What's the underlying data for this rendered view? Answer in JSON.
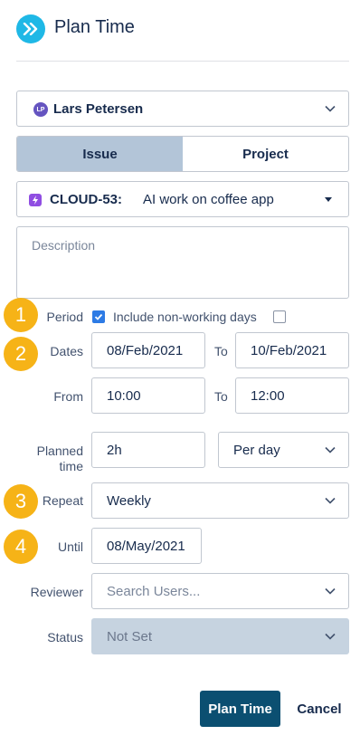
{
  "header": {
    "title": "Plan Time",
    "icon": "double-chevron-right-icon",
    "icon_color": "#1fb8e6"
  },
  "user": {
    "initials": "LP",
    "name": "Lars Petersen"
  },
  "tabs": [
    {
      "label": "Issue",
      "active": true
    },
    {
      "label": "Project",
      "active": false
    }
  ],
  "issue": {
    "key": "CLOUD-53:",
    "summary": "AI work on coffee app"
  },
  "description": {
    "placeholder": "Description"
  },
  "badges": [
    "1",
    "2",
    "3",
    "4"
  ],
  "period": {
    "label": "Period",
    "include_nonworking_label": "Include non-working days",
    "period_checked": true,
    "nonworking_checked": false
  },
  "dates": {
    "label": "Dates",
    "from": "08/Feb/2021",
    "to_label": "To",
    "to": "10/Feb/2021"
  },
  "time": {
    "label": "From",
    "from": "10:00",
    "to_label": "To",
    "to": "12:00"
  },
  "planned": {
    "label_line1": "Planned",
    "label_line2": "time",
    "value": "2h",
    "unit": "Per day"
  },
  "repeat": {
    "label": "Repeat",
    "value": "Weekly"
  },
  "until": {
    "label": "Until",
    "value": "08/May/2021"
  },
  "reviewer": {
    "label": "Reviewer",
    "placeholder": "Search Users..."
  },
  "status": {
    "label": "Status",
    "value": "Not Set"
  },
  "actions": {
    "submit": "Plan Time",
    "cancel": "Cancel"
  },
  "colors": {
    "accent": "#2d7be5",
    "primary_button": "#0b4f71",
    "badge": "#f6b317",
    "active_tab": "#b3c5d8"
  }
}
